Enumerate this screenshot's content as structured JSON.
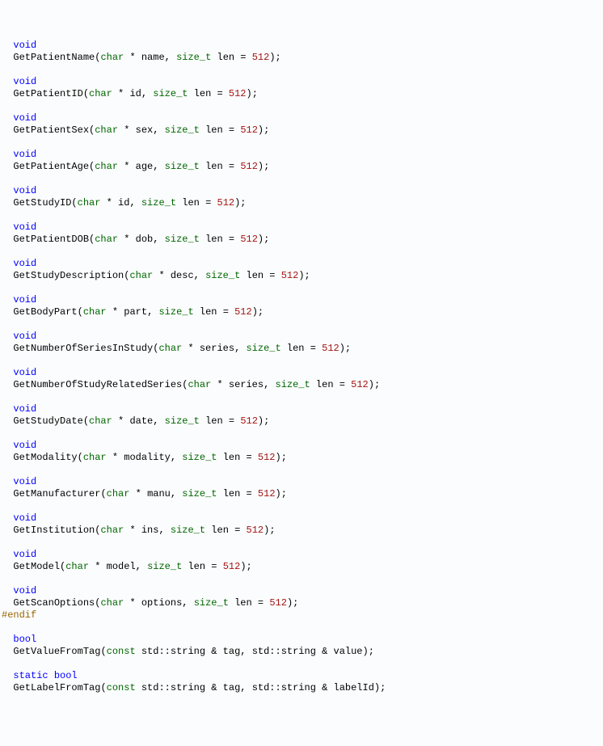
{
  "code": {
    "functions": [
      {
        "name": "GetPatientName",
        "ret": "void",
        "param_type": "char",
        "param_name": "name",
        "len_type": "size_t",
        "len_name": "len",
        "len_default": "512"
      },
      {
        "name": "GetPatientID",
        "ret": "void",
        "param_type": "char",
        "param_name": "id",
        "len_type": "size_t",
        "len_name": "len",
        "len_default": "512"
      },
      {
        "name": "GetPatientSex",
        "ret": "void",
        "param_type": "char",
        "param_name": "sex",
        "len_type": "size_t",
        "len_name": "len",
        "len_default": "512"
      },
      {
        "name": "GetPatientAge",
        "ret": "void",
        "param_type": "char",
        "param_name": "age",
        "len_type": "size_t",
        "len_name": "len",
        "len_default": "512"
      },
      {
        "name": "GetStudyID",
        "ret": "void",
        "param_type": "char",
        "param_name": "id",
        "len_type": "size_t",
        "len_name": "len",
        "len_default": "512"
      },
      {
        "name": "GetPatientDOB",
        "ret": "void",
        "param_type": "char",
        "param_name": "dob",
        "len_type": "size_t",
        "len_name": "len",
        "len_default": "512"
      },
      {
        "name": "GetStudyDescription",
        "ret": "void",
        "param_type": "char",
        "param_name": "desc",
        "len_type": "size_t",
        "len_name": "len",
        "len_default": "512"
      },
      {
        "name": "GetBodyPart",
        "ret": "void",
        "param_type": "char",
        "param_name": "part",
        "len_type": "size_t",
        "len_name": "len",
        "len_default": "512"
      },
      {
        "name": "GetNumberOfSeriesInStudy",
        "ret": "void",
        "param_type": "char",
        "param_name": "series",
        "len_type": "size_t",
        "len_name": "len",
        "len_default": "512"
      },
      {
        "name": "GetNumberOfStudyRelatedSeries",
        "ret": "void",
        "param_type": "char",
        "param_name": "series",
        "len_type": "size_t",
        "len_name": "len",
        "len_default": "512"
      },
      {
        "name": "GetStudyDate",
        "ret": "void",
        "param_type": "char",
        "param_name": "date",
        "len_type": "size_t",
        "len_name": "len",
        "len_default": "512"
      },
      {
        "name": "GetModality",
        "ret": "void",
        "param_type": "char",
        "param_name": "modality",
        "len_type": "size_t",
        "len_name": "len",
        "len_default": "512"
      },
      {
        "name": "GetManufacturer",
        "ret": "void",
        "param_type": "char",
        "param_name": "manu",
        "len_type": "size_t",
        "len_name": "len",
        "len_default": "512"
      },
      {
        "name": "GetInstitution",
        "ret": "void",
        "param_type": "char",
        "param_name": "ins",
        "len_type": "size_t",
        "len_name": "len",
        "len_default": "512"
      },
      {
        "name": "GetModel",
        "ret": "void",
        "param_type": "char",
        "param_name": "model",
        "len_type": "size_t",
        "len_name": "len",
        "len_default": "512"
      },
      {
        "name": "GetScanOptions",
        "ret": "void",
        "param_type": "char",
        "param_name": "options",
        "len_type": "size_t",
        "len_name": "len",
        "len_default": "512"
      }
    ],
    "endif": "#endif",
    "kw_static": "static",
    "kw_bool": "bool",
    "kw_const": "const",
    "fn_getvalue": "GetValueFromTag",
    "fn_getlabel": "GetLabelFromTag",
    "sig_tag": "std::string & tag",
    "sig_value": "std::string & value",
    "sig_labelId": "std::string & labelId"
  },
  "indent": "  "
}
